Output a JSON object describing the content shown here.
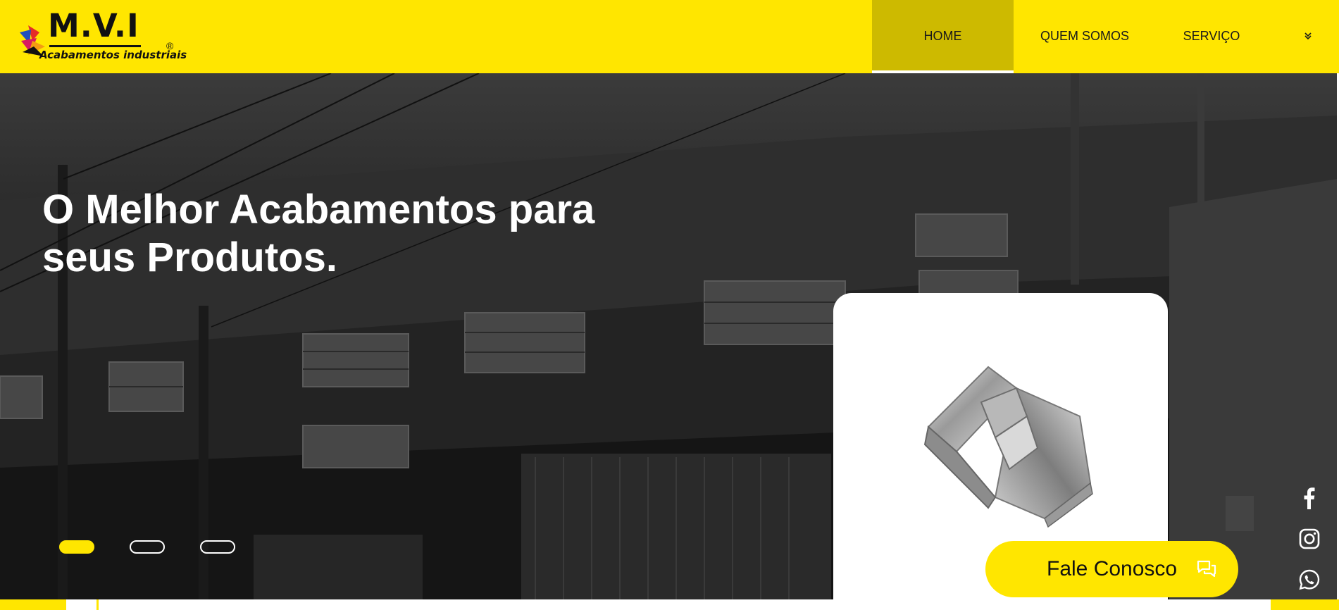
{
  "brand": {
    "name": "M.V.I",
    "subtitle": "Acabamentos industriais",
    "registered_mark": "®",
    "colors": {
      "primary_yellow": "#ffe600",
      "active_nav": "#cdba00"
    }
  },
  "nav": {
    "items": [
      {
        "label": "HOME",
        "active": true
      },
      {
        "label": "QUEM SOMOS",
        "active": false
      },
      {
        "label": "SERVIÇO",
        "active": false
      }
    ],
    "more_icon": "double-chevron-down-icon",
    "more_glyph": "»"
  },
  "hero": {
    "title_line1": "O Melhor Acabamentos para",
    "title_line2": "seus Produtos.",
    "background": "factory-building-photo-grayscale",
    "slides": {
      "count": 3,
      "active_index": 0
    },
    "product_image": "chrome-glass-door-hinge"
  },
  "cta": {
    "label": "Fale Conosco",
    "icon": "chat-bubbles-icon"
  },
  "social": [
    {
      "name": "facebook",
      "icon": "facebook-icon"
    },
    {
      "name": "instagram",
      "icon": "instagram-icon"
    },
    {
      "name": "whatsapp",
      "icon": "whatsapp-icon"
    }
  ]
}
